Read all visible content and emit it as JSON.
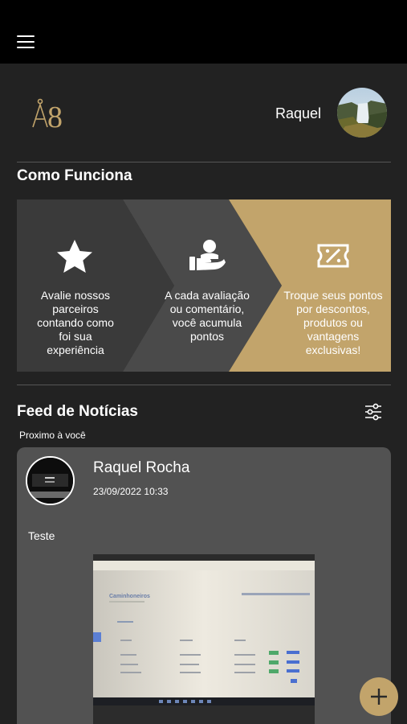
{
  "app": {
    "user_name": "Raquel",
    "accent_color": "#c2a46b"
  },
  "how_it_works": {
    "title": "Como Funciona",
    "steps": [
      {
        "icon": "star-icon",
        "text": "Avalie nossos parceiros contando como foi sua experiência"
      },
      {
        "icon": "hand-person-icon",
        "text": "A cada avaliação ou comentário, você acumula pontos"
      },
      {
        "icon": "discount-ticket-icon",
        "text": "Troque seus pontos por descontos, produtos ou vantagens exclusivas!"
      }
    ]
  },
  "feed": {
    "title": "Feed de Notícias",
    "subtitle": "Proximo à você",
    "filter_icon": "sliders-icon",
    "posts": [
      {
        "author": "Raquel Rocha",
        "date": "23/09/2022 10:33",
        "text": "Teste",
        "image_caption": "Caminhoneiros"
      }
    ]
  },
  "fab_icon": "plus-icon"
}
